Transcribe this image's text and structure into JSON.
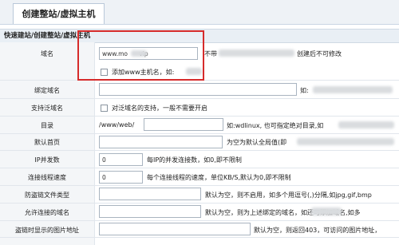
{
  "tab": {
    "title": "创建整站/虚拟主机"
  },
  "section": {
    "breadcrumb": "快速建站/创建整站/虚拟主机"
  },
  "rows": {
    "domain": {
      "label": "域名",
      "value": "www.mo      vip",
      "note": "不带",
      "note_tail": "创建后不可修改",
      "www_checkbox_label": "添加www主机名，如:"
    },
    "bind_domain": {
      "label": "绑定域名",
      "note": "如:"
    },
    "wildcard": {
      "label": "支持泛域名",
      "checkbox_label": "对泛域名的支持，一般不需要开启"
    },
    "directory": {
      "label": "目录",
      "value": "/www/web/",
      "note": "如:wdlinux, 也可指定绝对目录,如"
    },
    "default_page": {
      "label": "默认首页",
      "note": "为空为默认全局值(即"
    },
    "ip_conn": {
      "label": "IP并发数",
      "value": "0",
      "note": "每IP的并发连接数，如0,即不限制"
    },
    "conn_speed": {
      "label": "连接线程速度",
      "value": "0",
      "note": "每个连接线程的速度，单位KB/S,默认为0,即不限制"
    },
    "hotlink_types": {
      "label": "防盗链文件类型",
      "note": "默认为空，则不启用，如多个用逗号(,)分隔,如jpg,gif,bmp"
    },
    "allowed_domains": {
      "label": "允许连接的域名",
      "note": "默认为空，则为上述绑定的域名，如还可添加域名,如多"
    },
    "hotlink_image": {
      "label": "盗链时显示的图片地址",
      "note": "默认为空，则返回403，可访问的图片地址，"
    }
  }
}
